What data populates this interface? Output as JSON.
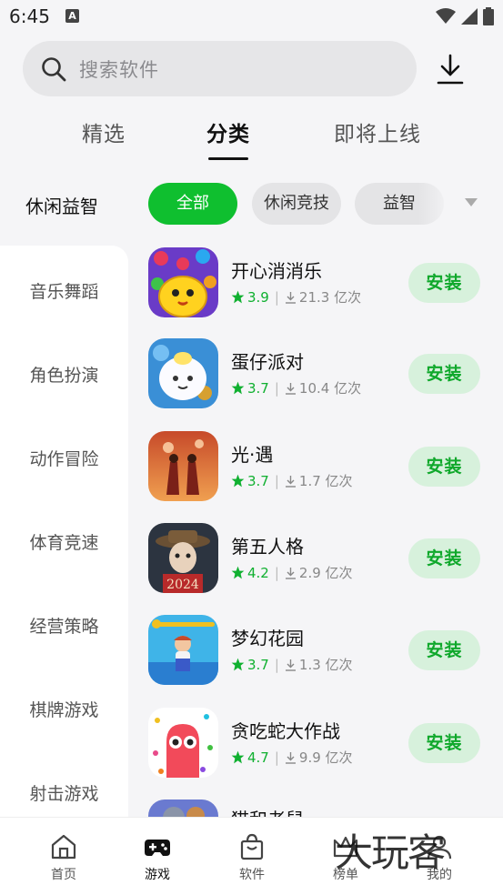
{
  "status_bar": {
    "time": "6:45",
    "notification_letter": "A"
  },
  "search": {
    "placeholder": "搜索软件"
  },
  "top_tabs": [
    {
      "label": "精选",
      "active": false
    },
    {
      "label": "分类",
      "active": true
    },
    {
      "label": "即将上线",
      "active": false
    }
  ],
  "category": {
    "title": "休闲益智",
    "chips": [
      {
        "label": "全部",
        "active": true
      },
      {
        "label": "休闲竞技",
        "active": false
      },
      {
        "label": "益智",
        "active": false
      }
    ]
  },
  "sidebar": {
    "items": [
      "音乐舞蹈",
      "角色扮演",
      "动作冒险",
      "体育竞速",
      "经营策略",
      "棋牌游戏",
      "射击游戏"
    ]
  },
  "apps": [
    {
      "name": "开心消消乐",
      "rating": "3.9",
      "downloads": "21.3 亿次",
      "button": "安装"
    },
    {
      "name": "蛋仔派对",
      "rating": "3.7",
      "downloads": "10.4 亿次",
      "button": "安装"
    },
    {
      "name": "光·遇",
      "rating": "3.7",
      "downloads": "1.7 亿次",
      "button": "安装"
    },
    {
      "name": "第五人格",
      "rating": "4.2",
      "downloads": "2.9 亿次",
      "button": "安装"
    },
    {
      "name": "梦幻花园",
      "rating": "3.7",
      "downloads": "1.3 亿次",
      "button": "安装"
    },
    {
      "name": "贪吃蛇大作战",
      "rating": "4.7",
      "downloads": "9.9 亿次",
      "button": "安装"
    },
    {
      "name": "猫和老鼠",
      "rating": "",
      "downloads": "",
      "button": ""
    }
  ],
  "bottom_nav": [
    {
      "label": "首页",
      "icon": "home-icon",
      "active": false
    },
    {
      "label": "游戏",
      "icon": "gamepad-icon",
      "active": true
    },
    {
      "label": "软件",
      "icon": "bag-icon",
      "active": false
    },
    {
      "label": "榜单",
      "icon": "crown-icon",
      "active": false
    },
    {
      "label": "我的",
      "icon": "user-icon",
      "active": false
    }
  ],
  "watermark": "大玩客",
  "colors": {
    "accent": "#0fbf2f",
    "install_bg": "#d7f1dc",
    "install_text": "#0fa82b"
  }
}
